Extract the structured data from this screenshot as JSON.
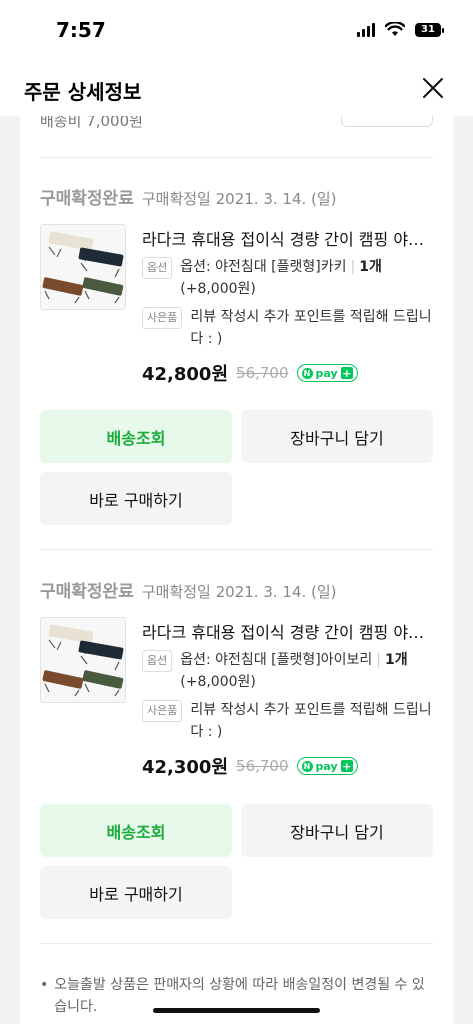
{
  "status_bar": {
    "time": "7:57",
    "battery": "31"
  },
  "header": {
    "title": "주문 상세정보"
  },
  "partial_top": {
    "text": "배송비 7,000원"
  },
  "items": [
    {
      "status": "구매확정완료",
      "date": "구매확정일 2021. 3. 14. (일)",
      "product_name": "라다크 휴대용 접이식 경량 간이 캠핑 야전침대",
      "option_chip": "옵션",
      "option_text": "옵션: 야전침대 [플랫형]카키",
      "quantity": "1개",
      "option_price": "(+8,000원)",
      "gift_chip": "사은품",
      "gift_text": "리뷰 작성시 추가 포인트를 적립해 드립니다 : )",
      "price": "42,800원",
      "original_price": "56,700",
      "npay_label": "pay",
      "buttons": {
        "track": "배송조회",
        "cart": "장바구니 담기",
        "buy": "바로 구매하기"
      }
    },
    {
      "status": "구매확정완료",
      "date": "구매확정일 2021. 3. 14. (일)",
      "product_name": "라다크 휴대용 접이식 경량 간이 캠핑 야전침대",
      "option_chip": "옵션",
      "option_text": "옵션: 야전침대 [플랫형]아이보리",
      "quantity": "1개",
      "option_price": "(+8,000원)",
      "gift_chip": "사은품",
      "gift_text": "리뷰 작성시 추가 포인트를 적립해 드립니다 : )",
      "price": "42,300원",
      "original_price": "56,700",
      "npay_label": "pay",
      "buttons": {
        "track": "배송조회",
        "cart": "장바구니 담기",
        "buy": "바로 구매하기"
      }
    }
  ],
  "note": "오늘출발 상품은 판매자의 상황에 따라 배송일정이 변경될 수 있습니다.",
  "colors": {
    "accent_green": "#1bab3b",
    "button_green_bg": "#e6f9ea",
    "npay_green": "#03c75a"
  }
}
